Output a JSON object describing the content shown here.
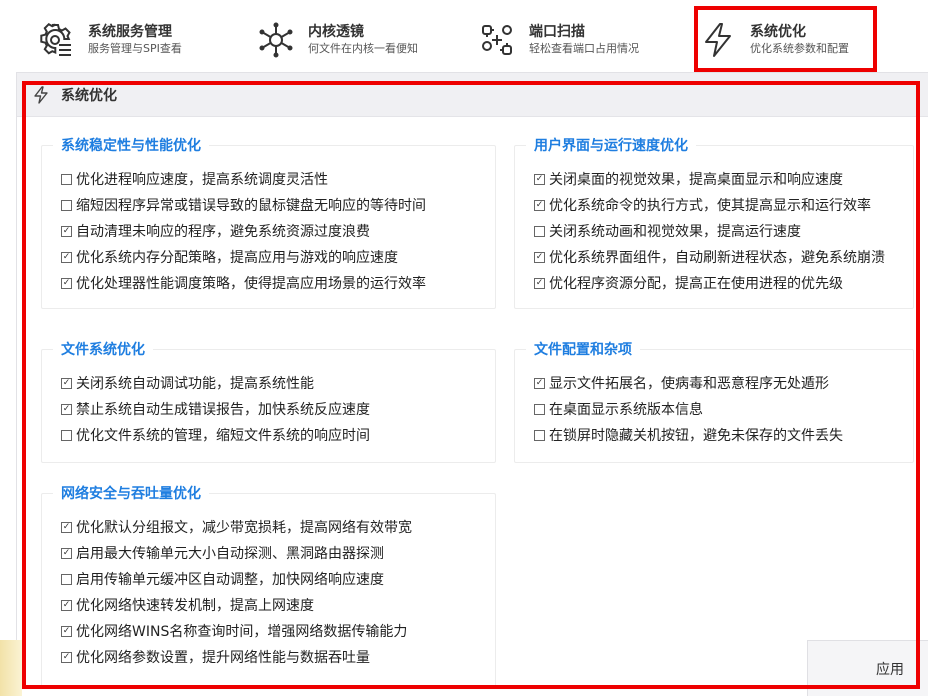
{
  "toolbar": {
    "items": [
      {
        "title": "系统服务管理",
        "subtitle": "服务管理与SPI查看",
        "icon": "gear-list-icon"
      },
      {
        "title": "内核透镜",
        "subtitle": "何文件在内核一看便知",
        "icon": "virus-lens-icon"
      },
      {
        "title": "端口扫描",
        "subtitle": "轻松查看端口占用情况",
        "icon": "port-scan-icon"
      },
      {
        "title": "系统优化",
        "subtitle": "优化系统参数和配置",
        "icon": "lightning-icon"
      }
    ]
  },
  "panel": {
    "title": "系统优化",
    "groups": [
      {
        "title": "系统稳定性与性能优化",
        "options": [
          {
            "label": "优化进程响应速度，提高系统调度灵活性",
            "checked": false
          },
          {
            "label": "缩短因程序异常或错误导致的鼠标键盘无响应的等待时间",
            "checked": false
          },
          {
            "label": "自动清理未响应的程序，避免系统资源过度浪费",
            "checked": true
          },
          {
            "label": "优化系统内存分配策略，提高应用与游戏的响应速度",
            "checked": true
          },
          {
            "label": "优化处理器性能调度策略，使得提高应用场景的运行效率",
            "checked": true
          }
        ]
      },
      {
        "title": "用户界面与运行速度优化",
        "options": [
          {
            "label": "关闭桌面的视觉效果，提高桌面显示和响应速度",
            "checked": true
          },
          {
            "label": "优化系统命令的执行方式，使其提高显示和运行效率",
            "checked": true
          },
          {
            "label": "关闭系统动画和视觉效果，提高运行速度",
            "checked": false
          },
          {
            "label": "优化系统界面组件，自动刷新进程状态，避免系统崩溃",
            "checked": true
          },
          {
            "label": "优化程序资源分配，提高正在使用进程的优先级",
            "checked": true
          }
        ]
      },
      {
        "title": "文件系统优化",
        "options": [
          {
            "label": "关闭系统自动调试功能，提高系统性能",
            "checked": true
          },
          {
            "label": "禁止系统自动生成错误报告，加快系统反应速度",
            "checked": true
          },
          {
            "label": "优化文件系统的管理，缩短文件系统的响应时间",
            "checked": false
          }
        ]
      },
      {
        "title": "文件配置和杂项",
        "options": [
          {
            "label": "显示文件拓展名，使病毒和恶意程序无处遁形",
            "checked": true
          },
          {
            "label": "在桌面显示系统版本信息",
            "checked": false
          },
          {
            "label": "在锁屏时隐藏关机按钮，避免未保存的文件丢失",
            "checked": false
          }
        ]
      },
      {
        "title": "网络安全与吞吐量优化",
        "options": [
          {
            "label": "优化默认分组报文，减少带宽损耗，提高网络有效带宽",
            "checked": true
          },
          {
            "label": "启用最大传输单元大小自动探测、黑洞路由器探测",
            "checked": true
          },
          {
            "label": "启用传输单元缓冲区自动调整，加快网络响应速度",
            "checked": false
          },
          {
            "label": "优化网络快速转发机制，提高上网速度",
            "checked": true
          },
          {
            "label": "优化网络WINS名称查询时间，增强网络数据传输能力",
            "checked": true
          },
          {
            "label": "优化网络参数设置，提升网络性能与数据吞吐量",
            "checked": true
          }
        ]
      }
    ],
    "apply_label": "应用"
  },
  "colors": {
    "accent": "#1f7ee0",
    "highlight": "#ee0000"
  }
}
